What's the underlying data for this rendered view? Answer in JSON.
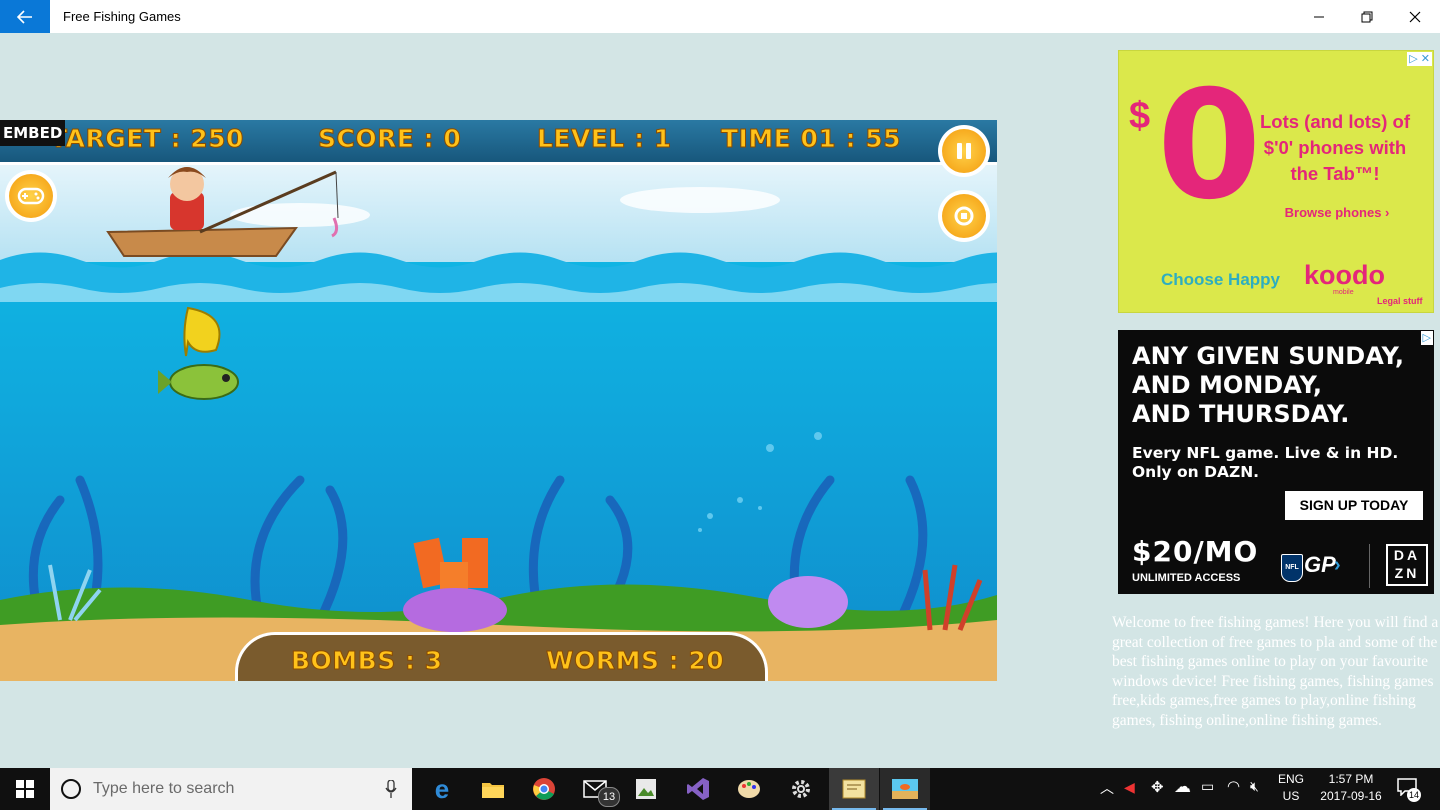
{
  "window": {
    "title": "Free Fishing Games"
  },
  "game": {
    "embed_label": "EMBED",
    "hud": {
      "target": "TARGET : 250",
      "score": "SCORE : 0",
      "level": "LEVEL : 1",
      "time": "TIME  01 : 55",
      "bombs": "BOMBS : 3",
      "worms": "WORMS : 20"
    }
  },
  "ads": {
    "koodo": {
      "dollar": "$",
      "zero": "0",
      "headline": "Lots (and lots) of $'0' phones with the Tab™!",
      "cta": "Browse phones ›",
      "tagline": "Choose Happy",
      "brand": "koodo",
      "brand_sub": "mobile",
      "legal": "Legal stuff"
    },
    "dazn": {
      "headline_1": "ANY GIVEN SUNDAY,",
      "headline_2": "AND MONDAY,",
      "headline_3": "AND THURSDAY.",
      "body_1": "Every NFL game. Live & in HD.",
      "body_2": "Only on DAZN.",
      "cta": "SIGN UP TODAY",
      "price": "$20/MO",
      "price_sub": "UNLIMITED ACCESS",
      "gp": "GP",
      "nfl": "NFL",
      "brand_top": "DA",
      "brand_bottom": "ZN"
    }
  },
  "welcome_text": "Welcome to free fishing games! Here you will find a great collection of free games to pla and some of the best fishing games online to play on your favourite windows device! Free fishing games, fishing games free,kids games,free games to play,online fishing games, fishing online,online fishing games.",
  "taskbar": {
    "search_placeholder": "Type here to search",
    "mail_badge": "13",
    "lang_1": "ENG",
    "lang_2": "US",
    "time": "1:57 PM",
    "date": "2017-09-16",
    "notification_count": "14"
  }
}
